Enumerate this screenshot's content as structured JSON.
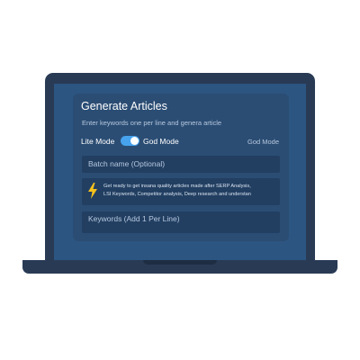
{
  "app": {
    "title": "Generate Articles",
    "subtitle": "Enter keywords one per line and genera article"
  },
  "mode": {
    "lite_label": "Lite Mode",
    "god_label": "God Mode",
    "current": "God Mode",
    "toggle_on": true
  },
  "batch_name": {
    "placeholder": "Batch name (Optional)",
    "value": ""
  },
  "info": {
    "icon": "lightning-bolt-icon",
    "line1": "Get ready to get insana quality articles made after SERP Analysis,",
    "line2": "LSI Keywords, Competitor analysis, Deep research and understan"
  },
  "keywords": {
    "placeholder": "Keywords (Add 1 Per Line)",
    "value": ""
  },
  "colors": {
    "laptop_frame": "#293a55",
    "screen": "#2c5581",
    "card": "#2b4d74",
    "field": "#223f62",
    "toggle_accent": "#47a3ee",
    "bolt": "#f5c11c"
  }
}
